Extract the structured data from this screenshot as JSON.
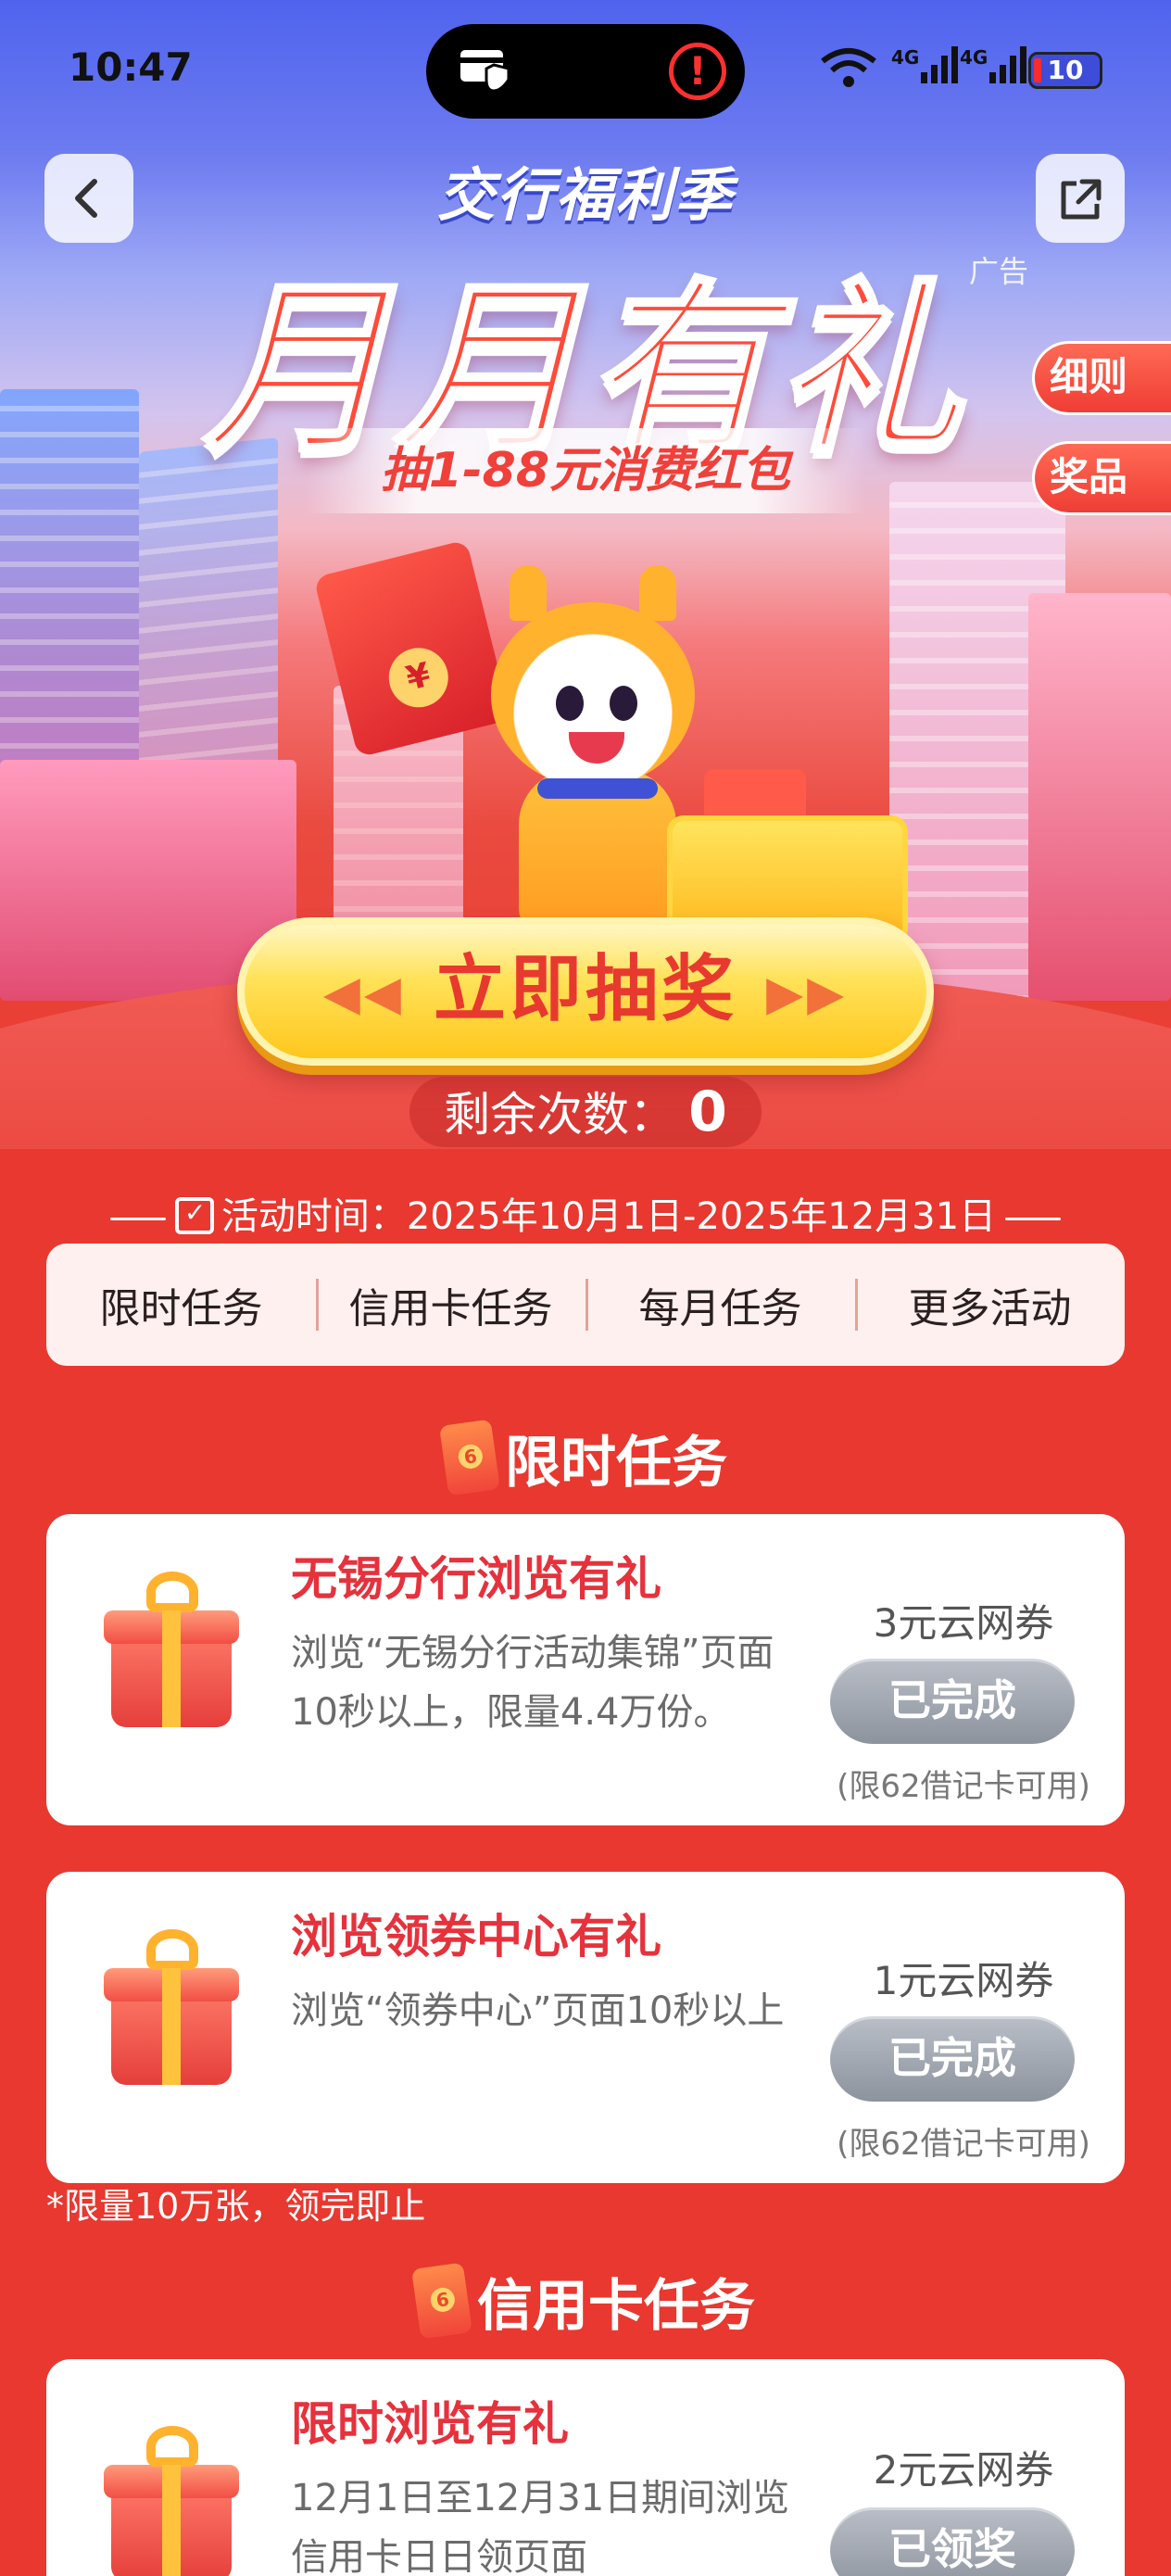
{
  "status_bar": {
    "time": "10:47",
    "network_1": "4G",
    "network_2": "4G",
    "battery": "10"
  },
  "header": {
    "brand": "交行福利季",
    "title": "月月有礼",
    "subtitle": "抽1-88元消费红包",
    "ad_label": "广告",
    "side_tabs": [
      "细则",
      "奖品"
    ]
  },
  "draw": {
    "button_label": "立即抽奖",
    "remaining_label": "剩余次数：",
    "remaining_count": "0"
  },
  "activity": {
    "time_label": "活动时间：2025年10月1日-2025年12月31日"
  },
  "task_tabs": [
    "限时任务",
    "信用卡任务",
    "每月任务",
    "更多活动"
  ],
  "sections": {
    "limited": {
      "title": "限时任务",
      "cards": [
        {
          "title": "无锡分行浏览有礼",
          "desc": "浏览“无锡分行活动集锦”页面10秒以上，限量4.4万份。",
          "reward": "3元云网券",
          "button": "已完成",
          "note": "(限62借记卡可用)"
        },
        {
          "title": "浏览领券中心有礼",
          "desc": "浏览“领券中心”页面10秒以上",
          "reward": "1元云网券",
          "button": "已完成",
          "note": "(限62借记卡可用)"
        }
      ],
      "footnote": "*限量10万张，领完即止"
    },
    "credit": {
      "title": "信用卡任务",
      "cards": [
        {
          "title": "限时浏览有礼",
          "desc": "12月1日至12月31日期间浏览信用卡日日领页面",
          "reward": "2元云网券",
          "button": "已领奖"
        }
      ]
    }
  },
  "colors": {
    "brand_red": "#e8382f",
    "card_title_red": "#e5323c",
    "done_button_gray": "#9aa0aa",
    "draw_button_yellow": "#ffd23a"
  },
  "icons": [
    "back-icon",
    "share-icon",
    "calendar-icon",
    "gift-icon",
    "red-envelope-icon",
    "wifi-icon",
    "signal-icon",
    "battery-icon",
    "alert-icon",
    "shield-card-icon"
  ]
}
